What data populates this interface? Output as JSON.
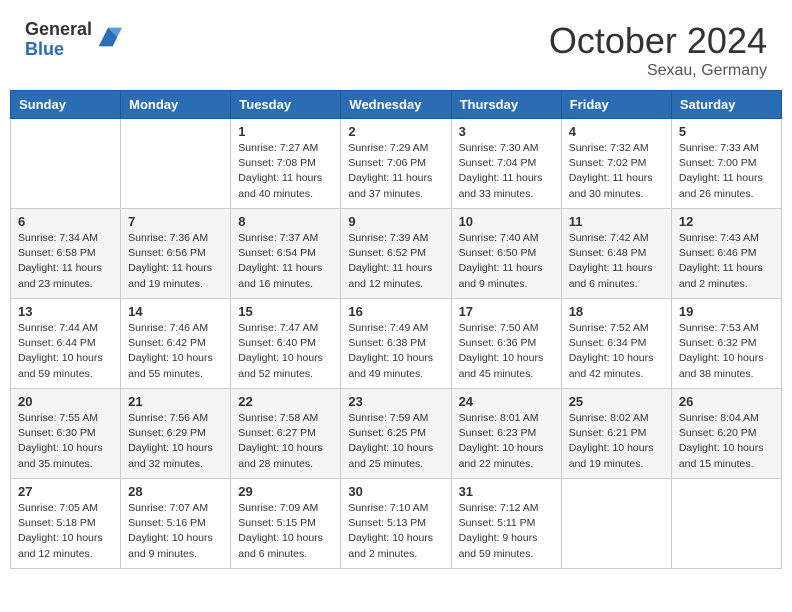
{
  "header": {
    "logo_general": "General",
    "logo_blue": "Blue",
    "month_title": "October 2024",
    "location": "Sexau, Germany"
  },
  "days_of_week": [
    "Sunday",
    "Monday",
    "Tuesday",
    "Wednesday",
    "Thursday",
    "Friday",
    "Saturday"
  ],
  "weeks": [
    [
      {
        "day": "",
        "info": ""
      },
      {
        "day": "",
        "info": ""
      },
      {
        "day": "1",
        "info": "Sunrise: 7:27 AM\nSunset: 7:08 PM\nDaylight: 11 hours and 40 minutes."
      },
      {
        "day": "2",
        "info": "Sunrise: 7:29 AM\nSunset: 7:06 PM\nDaylight: 11 hours and 37 minutes."
      },
      {
        "day": "3",
        "info": "Sunrise: 7:30 AM\nSunset: 7:04 PM\nDaylight: 11 hours and 33 minutes."
      },
      {
        "day": "4",
        "info": "Sunrise: 7:32 AM\nSunset: 7:02 PM\nDaylight: 11 hours and 30 minutes."
      },
      {
        "day": "5",
        "info": "Sunrise: 7:33 AM\nSunset: 7:00 PM\nDaylight: 11 hours and 26 minutes."
      }
    ],
    [
      {
        "day": "6",
        "info": "Sunrise: 7:34 AM\nSunset: 6:58 PM\nDaylight: 11 hours and 23 minutes."
      },
      {
        "day": "7",
        "info": "Sunrise: 7:36 AM\nSunset: 6:56 PM\nDaylight: 11 hours and 19 minutes."
      },
      {
        "day": "8",
        "info": "Sunrise: 7:37 AM\nSunset: 6:54 PM\nDaylight: 11 hours and 16 minutes."
      },
      {
        "day": "9",
        "info": "Sunrise: 7:39 AM\nSunset: 6:52 PM\nDaylight: 11 hours and 12 minutes."
      },
      {
        "day": "10",
        "info": "Sunrise: 7:40 AM\nSunset: 6:50 PM\nDaylight: 11 hours and 9 minutes."
      },
      {
        "day": "11",
        "info": "Sunrise: 7:42 AM\nSunset: 6:48 PM\nDaylight: 11 hours and 6 minutes."
      },
      {
        "day": "12",
        "info": "Sunrise: 7:43 AM\nSunset: 6:46 PM\nDaylight: 11 hours and 2 minutes."
      }
    ],
    [
      {
        "day": "13",
        "info": "Sunrise: 7:44 AM\nSunset: 6:44 PM\nDaylight: 10 hours and 59 minutes."
      },
      {
        "day": "14",
        "info": "Sunrise: 7:46 AM\nSunset: 6:42 PM\nDaylight: 10 hours and 55 minutes."
      },
      {
        "day": "15",
        "info": "Sunrise: 7:47 AM\nSunset: 6:40 PM\nDaylight: 10 hours and 52 minutes."
      },
      {
        "day": "16",
        "info": "Sunrise: 7:49 AM\nSunset: 6:38 PM\nDaylight: 10 hours and 49 minutes."
      },
      {
        "day": "17",
        "info": "Sunrise: 7:50 AM\nSunset: 6:36 PM\nDaylight: 10 hours and 45 minutes."
      },
      {
        "day": "18",
        "info": "Sunrise: 7:52 AM\nSunset: 6:34 PM\nDaylight: 10 hours and 42 minutes."
      },
      {
        "day": "19",
        "info": "Sunrise: 7:53 AM\nSunset: 6:32 PM\nDaylight: 10 hours and 38 minutes."
      }
    ],
    [
      {
        "day": "20",
        "info": "Sunrise: 7:55 AM\nSunset: 6:30 PM\nDaylight: 10 hours and 35 minutes."
      },
      {
        "day": "21",
        "info": "Sunrise: 7:56 AM\nSunset: 6:29 PM\nDaylight: 10 hours and 32 minutes."
      },
      {
        "day": "22",
        "info": "Sunrise: 7:58 AM\nSunset: 6:27 PM\nDaylight: 10 hours and 28 minutes."
      },
      {
        "day": "23",
        "info": "Sunrise: 7:59 AM\nSunset: 6:25 PM\nDaylight: 10 hours and 25 minutes."
      },
      {
        "day": "24",
        "info": "Sunrise: 8:01 AM\nSunset: 6:23 PM\nDaylight: 10 hours and 22 minutes."
      },
      {
        "day": "25",
        "info": "Sunrise: 8:02 AM\nSunset: 6:21 PM\nDaylight: 10 hours and 19 minutes."
      },
      {
        "day": "26",
        "info": "Sunrise: 8:04 AM\nSunset: 6:20 PM\nDaylight: 10 hours and 15 minutes."
      }
    ],
    [
      {
        "day": "27",
        "info": "Sunrise: 7:05 AM\nSunset: 5:18 PM\nDaylight: 10 hours and 12 minutes."
      },
      {
        "day": "28",
        "info": "Sunrise: 7:07 AM\nSunset: 5:16 PM\nDaylight: 10 hours and 9 minutes."
      },
      {
        "day": "29",
        "info": "Sunrise: 7:09 AM\nSunset: 5:15 PM\nDaylight: 10 hours and 6 minutes."
      },
      {
        "day": "30",
        "info": "Sunrise: 7:10 AM\nSunset: 5:13 PM\nDaylight: 10 hours and 2 minutes."
      },
      {
        "day": "31",
        "info": "Sunrise: 7:12 AM\nSunset: 5:11 PM\nDaylight: 9 hours and 59 minutes."
      },
      {
        "day": "",
        "info": ""
      },
      {
        "day": "",
        "info": ""
      }
    ]
  ]
}
